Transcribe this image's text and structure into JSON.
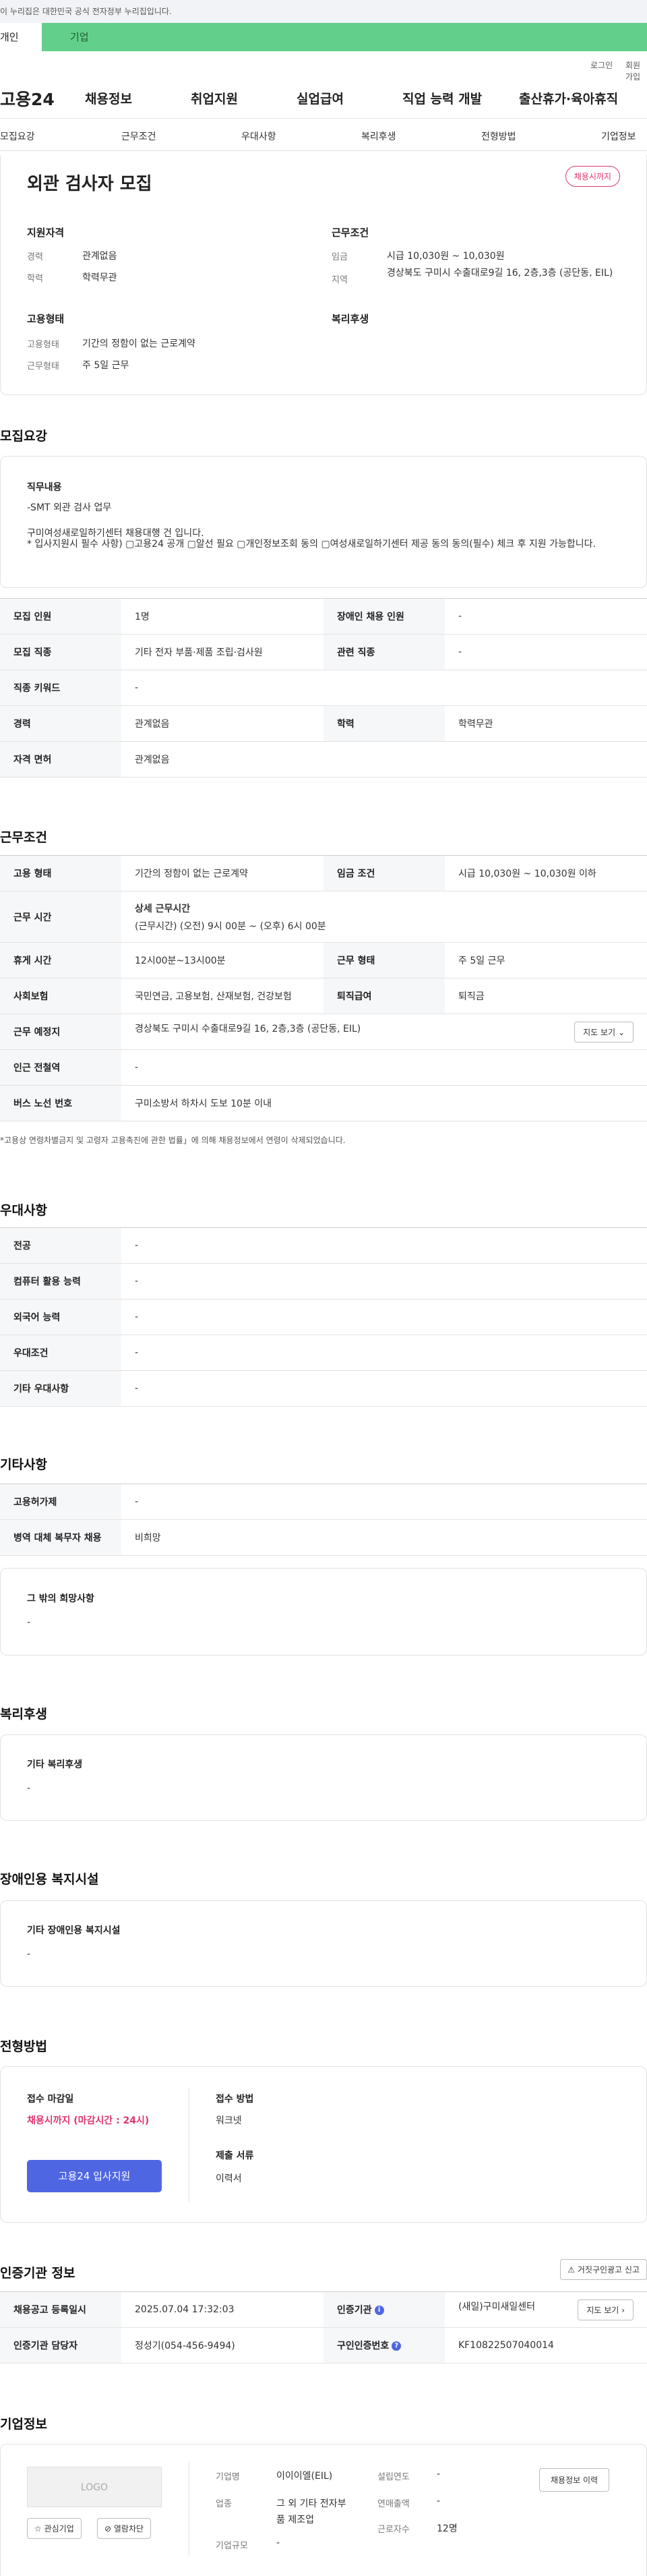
{
  "notice": "이 누리집은 대한민국 공식 전자정부 누리집입니다.",
  "usertabs": {
    "person": "개인",
    "company": "기업"
  },
  "utility": {
    "login": "로그인",
    "join": "회원가입"
  },
  "gnb": {
    "logo": "고용24",
    "menus": [
      "채용정보",
      "취업지원",
      "실업급여",
      "직업 능력 개발",
      "출산휴가·육아휴직"
    ]
  },
  "subnav": [
    "모집요강",
    "근무조건",
    "우대사항",
    "복리후생",
    "전형방법",
    "기업정보"
  ],
  "header": {
    "title": "외관 검사자 모집",
    "badge": "채용시까지",
    "qualification_title": "지원자격",
    "career_label": "경력",
    "career_value": "관계없음",
    "edu_label": "학력",
    "edu_value": "학력무관",
    "employ_title": "고용형태",
    "employ_label": "고용형태",
    "employ_value": "기간의 정함이 없는 근로계약",
    "worktype_label": "근무형태",
    "worktype_value": "주 5일 근무",
    "cond_title": "근무조건",
    "wage_label": "임금",
    "wage_value": "시급 10,030원 ~ 10,030원",
    "area_label": "지역",
    "area_value": "경상북도 구미시 수출대로9길 16, 2층,3층 (공단동, EIL)",
    "welfare_title": "복리후생"
  },
  "recruit": {
    "title": "모집요강",
    "duty_title": "직무내용",
    "duty_line1": "-SMT 외관 검사 업무",
    "duty_line2": "구미여성새로일하기센터 채용대행 건 입니다.",
    "duty_line3": "* 입사지원시 필수 사항) ▢고용24 공개 ▢알선 필요 ▢개인정보조회 동의 ▢여성새로일하기센터 제공 동의 동의(필수) 체크 후 지원 가능합니다.",
    "rows": [
      [
        "모집 인원",
        "1명",
        "장애인 채용 인원",
        "-"
      ],
      [
        "모집 직종",
        "기타 전자 부품·제품 조립·검사원",
        "관련 직종",
        "-"
      ],
      [
        "직종 키워드",
        "-"
      ],
      [
        "경력",
        "관계없음",
        "학력",
        "학력무관"
      ],
      [
        "자격 면허",
        "관계없음"
      ]
    ]
  },
  "workcond": {
    "title": "근무조건",
    "employ_label": "고용 형태",
    "employ_value": "기간의 정함이 없는 근로계약",
    "wage_label": "임금 조건",
    "wage_value": "시급 10,030원 ~ 10,030원 이하",
    "time_label": "근무 시간",
    "time_detail_title": "상세 근무시간",
    "time_detail": "(근무시간) (오전) 9시 00분 ~ (오후) 6시 00분",
    "rest_label": "휴게 시간",
    "rest_value": "12시00분~13시00분",
    "type_label": "근무 형태",
    "type_value": "주 5일 근무",
    "ins_label": "사회보험",
    "ins_value": "국민연금, 고용보험, 산재보험, 건강보험",
    "retire_label": "퇴직급여",
    "retire_value": "퇴직금",
    "place_label": "근무 예정지",
    "place_value": "경상북도 구미시 수출대로9길 16, 2층,3층 (공단동, EIL)",
    "map_button": "지도 보기",
    "station_label": "인근 전철역",
    "station_value": "-",
    "bus_label": "버스 노선 번호",
    "bus_value": "구미소방서 하차시 도보 10분 이내",
    "footnote": "*고용상 연령차별금지 및 고령자 고용촉진에 관한 법률」에 의해 채용정보에서 연령이 삭제되었습니다."
  },
  "prefer": {
    "title": "우대사항",
    "rows": [
      [
        "전공",
        "-"
      ],
      [
        "컴퓨터 활용 능력",
        "-"
      ],
      [
        "외국어 능력",
        "-"
      ],
      [
        "우대조건",
        "-"
      ],
      [
        "기타 우대사항",
        "-"
      ]
    ]
  },
  "etc": {
    "title": "기타사항",
    "rows": [
      [
        "고용허가제",
        "-"
      ],
      [
        "병역 대체 복무자 채용",
        "비희망"
      ]
    ],
    "other_title": "그 밖의 희망사항",
    "other_value": "-"
  },
  "welfare": {
    "title": "복리후생",
    "box_title": "기타 복리후생",
    "box_value": "-"
  },
  "disabled": {
    "title": "장애인용 복지시설",
    "box_title": "기타 장애인용 복지시설",
    "box_value": "-"
  },
  "process": {
    "title": "전형방법",
    "deadline_title": "접수 마감일",
    "deadline_value": "채용시까지 (마감시간 : 24시)",
    "apply_button": "고용24 입사지원",
    "method_title": "접수 방법",
    "method_value": "워크넷",
    "docs_title": "제출 서류",
    "docs_value": "이력서"
  },
  "certified": {
    "title": "인증기관 정보",
    "report_button": "거짓구인광고 신고",
    "reg_label": "채용공고 등록일시",
    "reg_value": "2025.07.04 17:32:03",
    "org_label": "인증기관",
    "org_value": "(새일)구미새일센터",
    "map_button": "지도 보기",
    "manager_label": "인증기관 담당자",
    "manager_value": "정성기(054-456-9494)",
    "num_label": "구인인증번호",
    "num_value": "KF10822507040014"
  },
  "company": {
    "title": "기업정보",
    "logo": "LOGO",
    "like_button": "관심기업",
    "block_button": "열람차단",
    "history_button": "채용정보 이력",
    "name_label": "기업명",
    "name_value": "이이이엘(EIL)",
    "industry_label": "업종",
    "industry_value": "그 외 기타 전자부품 제조업",
    "size_label": "기업규모",
    "size_value": "-",
    "founded_label": "설립연도",
    "founded_value": "-",
    "sales_label": "연매출액",
    "sales_value": "-",
    "staff_label": "근로자수",
    "staff_value": "12명"
  }
}
